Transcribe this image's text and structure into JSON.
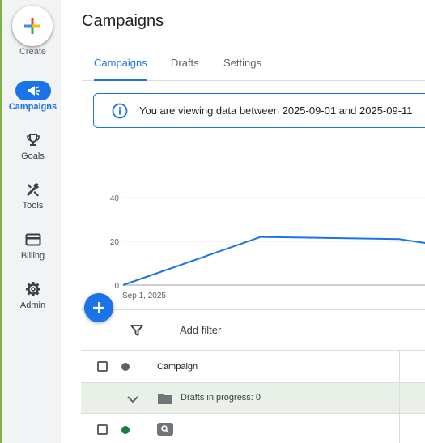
{
  "nav": {
    "create_label": "Create",
    "items": [
      {
        "label": "Campaigns",
        "icon": "megaphone-icon",
        "active": true
      },
      {
        "label": "Goals",
        "icon": "trophy-icon",
        "active": false
      },
      {
        "label": "Tools",
        "icon": "tools-icon",
        "active": false
      },
      {
        "label": "Billing",
        "icon": "credit-card-icon",
        "active": false
      },
      {
        "label": "Admin",
        "icon": "gear-icon",
        "active": false
      }
    ]
  },
  "page": {
    "title": "Campaigns",
    "tabs": [
      {
        "label": "Campaigns",
        "active": true
      },
      {
        "label": "Drafts",
        "active": false
      },
      {
        "label": "Settings",
        "active": false
      }
    ]
  },
  "banner": {
    "text": "You are viewing data between 2025-09-01 and 2025-09-11"
  },
  "chart_data": {
    "type": "line",
    "x_tick_labels": [
      "Sep 1, 2025"
    ],
    "y_ticks": [
      0,
      20,
      40
    ],
    "ylim": [
      0,
      40
    ],
    "series": [
      {
        "values": [
          0,
          22,
          21,
          19
        ]
      }
    ],
    "grid": true
  },
  "filter": {
    "add_filter_label": "Add filter"
  },
  "table": {
    "header": {
      "campaign": "Campaign"
    },
    "drafts_row": {
      "text": "Drafts in progress: 0"
    }
  },
  "colors": {
    "accent": "#1a73e8",
    "enabled_dot": "#188038",
    "header_dot": "#5f6368",
    "rail_accent": "#7cb342"
  }
}
